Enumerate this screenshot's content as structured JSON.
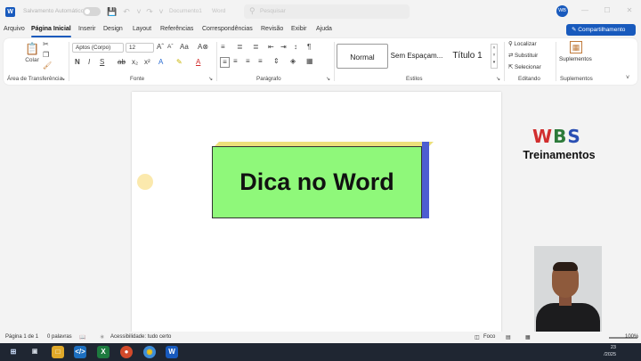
{
  "titlebar": {
    "app_badge": "W",
    "autosave_label": "Salvamento Automático",
    "doc_name": "Documento1",
    "save_state": "Word",
    "search_placeholder": "Pesquisar",
    "avatar_initials": "WB"
  },
  "tabs": [
    {
      "label": "Arquivo"
    },
    {
      "label": "Página Inicial"
    },
    {
      "label": "Inserir"
    },
    {
      "label": "Design"
    },
    {
      "label": "Layout"
    },
    {
      "label": "Referências"
    },
    {
      "label": "Correspondências"
    },
    {
      "label": "Revisão"
    },
    {
      "label": "Exibir"
    },
    {
      "label": "Ajuda"
    }
  ],
  "active_tab": "Página Inicial",
  "share_button": "Compartilhamento",
  "ribbon": {
    "clipboard": {
      "paste_label": "Colar",
      "group_label": "Área de Transferência"
    },
    "font": {
      "font_name": "Aptos (Corpo)",
      "font_size": "12",
      "group_label": "Fonte"
    },
    "paragraph": {
      "group_label": "Parágrafo"
    },
    "styles": {
      "items": [
        "Normal",
        "Sem Espaçam...",
        "Título 1"
      ],
      "group_label": "Estilos"
    },
    "editing": {
      "find": "Localizar",
      "replace": "Substituir",
      "select": "Selecionar",
      "group_label": "Editando"
    },
    "addins": {
      "label": "Suplementos",
      "group_label": "Suplementos"
    }
  },
  "document": {
    "box_title": "Dica no Word",
    "logo_w": "W",
    "logo_b": "B",
    "logo_s": "S",
    "logo_sub": "Treinamentos"
  },
  "colors": {
    "accent": "#185abd",
    "box_front": "#8ff87a",
    "box_top": "#ece07a",
    "box_side": "#4d5ed1"
  },
  "statusbar": {
    "page": "Página 1 de 1",
    "words": "0 palavras",
    "accessibility": "Acessibilidade: tudo certo",
    "focus": "Foco",
    "zoom": "100%"
  },
  "taskbar": {
    "time": "23",
    "date": "/2025"
  }
}
